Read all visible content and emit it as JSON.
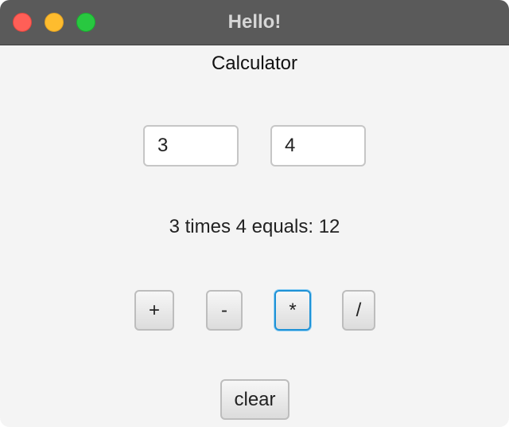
{
  "window": {
    "title": "Hello!",
    "controls": [
      "close-icon",
      "minimize-icon",
      "zoom-icon"
    ]
  },
  "app": {
    "heading": "Calculator",
    "operand1": "3",
    "operand2": "4",
    "result_text": "3 times 4 equals: 12"
  },
  "buttons": {
    "plus": "+",
    "minus": "-",
    "multiply": "*",
    "divide": "/",
    "clear": "clear"
  },
  "colors": {
    "titlebar": "#5a5a5a",
    "close": "#ff5f57",
    "minimize": "#febc2e",
    "zoom": "#28c840",
    "focus_ring": "#1f92d6"
  }
}
